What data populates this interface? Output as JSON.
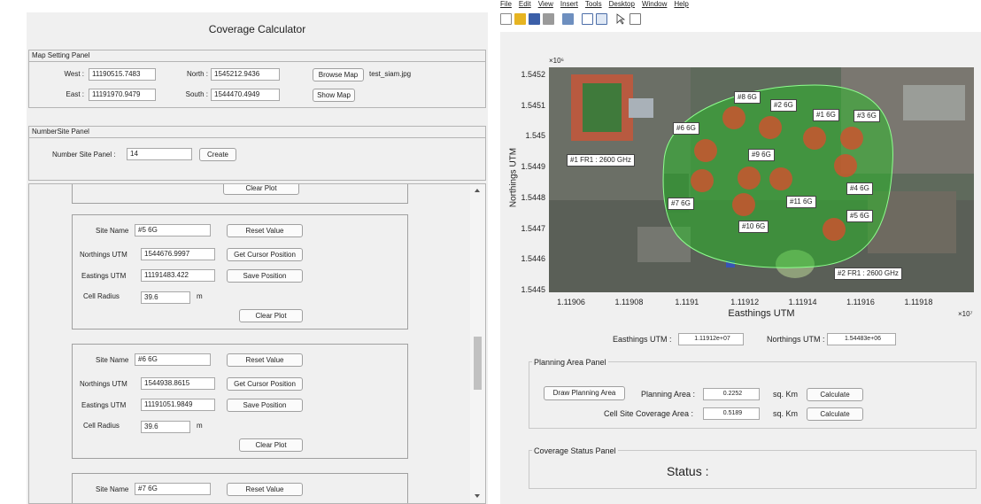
{
  "left": {
    "title": "Coverage Calculator",
    "map_setting": {
      "panel_title": "Map Setting Panel",
      "west_label": "West :",
      "west_value": "11190515.7483",
      "north_label": "North :",
      "north_value": "1545212.9436",
      "east_label": "East :",
      "east_value": "11191970.9479",
      "south_label": "South :",
      "south_value": "1544470.4949",
      "browse_label": "Browse Map",
      "file_name": "test_siam.jpg",
      "show_label": "Show Map"
    },
    "number_site": {
      "panel_title": "NumberSite Panel",
      "label": "Number Site Panel :",
      "value": "14",
      "create_label": "Create"
    },
    "clear_plot_top": "Clear Plot",
    "site_field_labels": {
      "name": "Site Name",
      "northings": "Northings UTM",
      "eastings": "Eastings UTM",
      "radius": "Cell Radius",
      "unit": "m"
    },
    "site_button_labels": {
      "reset": "Reset Value",
      "cursor": "Get Cursor Position",
      "save": "Save Position",
      "clear": "Clear Plot"
    },
    "sites": [
      {
        "name": "#5 6G",
        "northings": "1544676.9997",
        "eastings": "11191483.422",
        "radius": "39.6"
      },
      {
        "name": "#6 6G",
        "northings": "1544938.8615",
        "eastings": "11191051.9849",
        "radius": "39.6"
      },
      {
        "name": "#7 6G"
      }
    ]
  },
  "right": {
    "menu": [
      "File",
      "Edit",
      "View",
      "Insert",
      "Tools",
      "Desktop",
      "Window",
      "Help"
    ],
    "plot": {
      "y_exponent": "×10⁶",
      "x_exponent": "×10⁷",
      "ylabel": "Northings UTM",
      "xlabel": "Easthings UTM",
      "yticks": [
        "1.5452",
        "1.5451",
        "1.545",
        "1.5449",
        "1.5448",
        "1.5447",
        "1.5446",
        "1.5445"
      ],
      "xticks": [
        "1.11906",
        "1.11908",
        "1.1191",
        "1.11912",
        "1.11914",
        "1.11916",
        "1.11918"
      ],
      "site_labels": [
        "#8 6G",
        "#2 6G",
        "#1 6G",
        "#3 6G",
        "#6 6G",
        "#9 6G",
        "#4 6G",
        "#11 6G",
        "#7 6G",
        "#5 6G",
        "#10 6G"
      ],
      "fr_labels": [
        "#1 FR1 : 2600 GHz",
        "#2 FR1 : 2600 GHz"
      ],
      "colors": {
        "coverage": "#1ec81e",
        "site": "#d2502d"
      }
    },
    "cursor": {
      "east_label": "Easthings UTM :",
      "east_value": "1.11912e+07",
      "north_label": "Northings UTM :",
      "north_value": "1.54483e+06"
    },
    "planning": {
      "panel_title": "Planning Area Panel",
      "draw_label": "Draw Planning Area",
      "area_label": "Planning Area :",
      "area_value": "0.2252",
      "unit": "sq. Km",
      "calc_label": "Calculate",
      "coverage_label": "Cell Site Coverage Area :",
      "coverage_value": "0.5189"
    },
    "status": {
      "panel_title": "Coverage Status Panel",
      "label": "Status :"
    }
  }
}
